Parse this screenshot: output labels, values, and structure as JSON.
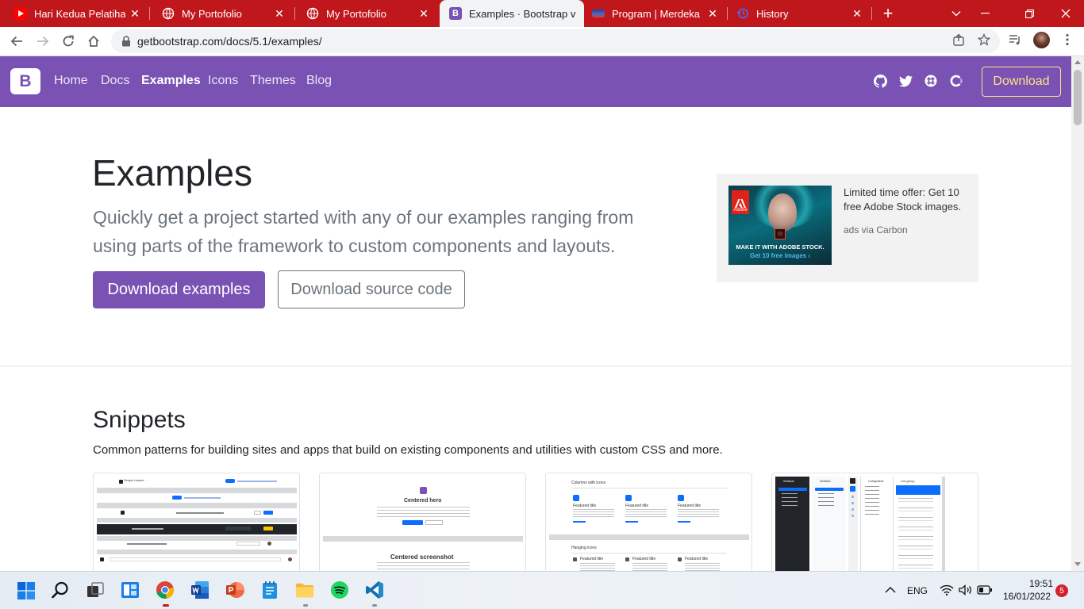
{
  "browser": {
    "tabs": [
      {
        "title": "Hari Kedua Pelatihan P",
        "favicon": "youtube-icon"
      },
      {
        "title": "My Portofolio",
        "favicon": "globe-icon"
      },
      {
        "title": "My Portofolio",
        "favicon": "globe-icon"
      },
      {
        "title": "Examples · Bootstrap v",
        "favicon": "bootstrap-icon",
        "active": true
      },
      {
        "title": "Program | Merdeka Be",
        "favicon": "merdeka-icon"
      },
      {
        "title": "History",
        "favicon": "history-icon"
      }
    ],
    "new_tab_label": "+",
    "url": "getbootstrap.com/docs/5.1/examples/"
  },
  "navbar": {
    "brand": "B",
    "links": [
      {
        "label": "Home"
      },
      {
        "label": "Docs"
      },
      {
        "label": "Examples",
        "active": true
      },
      {
        "label": "Icons"
      },
      {
        "label": "Themes"
      },
      {
        "label": "Blog"
      }
    ],
    "download_label": "Download",
    "accent_color": "#7952b3",
    "download_color": "#ffe484"
  },
  "hero": {
    "title": "Examples",
    "lead": "Quickly get a project started with any of our examples ranging from using parts of the framework to custom components and layouts.",
    "primary_button": "Download examples",
    "secondary_button": "Download source code"
  },
  "ad": {
    "logo_text": "Adobe",
    "app_badge": "St",
    "image_headline": "MAKE IT WITH ADOBE STOCK.",
    "image_cta": "Get 10 free images ›",
    "text": "Limited time offer: Get 10 free Adobe Stock images.",
    "via": "ads via Carbon"
  },
  "snippets": {
    "title": "Snippets",
    "description": "Common patterns for building sites and apps that build on existing components and utilities with custom CSS and more.",
    "cards": [
      {
        "name": "headers",
        "labels": [
          "Simple header"
        ]
      },
      {
        "name": "heroes",
        "labels": [
          "Centered hero",
          "Centered screenshot"
        ]
      },
      {
        "name": "features",
        "labels": [
          "Columns with icons",
          "Featured title",
          "Featured title",
          "Featured title",
          "Hanging icons",
          "Featured title",
          "Featured title",
          "Featured title"
        ]
      },
      {
        "name": "sidebars",
        "labels": [
          "Sidebar",
          "Sidebar",
          "Collapsible",
          "List group"
        ]
      }
    ]
  },
  "taskbar": {
    "apps": [
      "start-icon",
      "search-icon",
      "task-view-icon",
      "widgets-icon",
      "chrome-icon",
      "word-icon",
      "powerpoint-icon",
      "notepad-icon",
      "file-explorer-icon",
      "spotify-icon",
      "vscode-icon"
    ],
    "language": "ENG",
    "time": "19:51",
    "date": "16/01/2022",
    "notification_count": "5"
  }
}
